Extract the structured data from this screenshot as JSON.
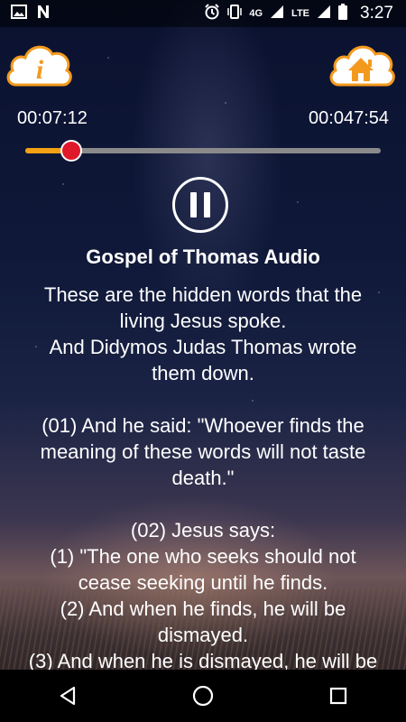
{
  "status_bar": {
    "left_icons": [
      "image-icon",
      "notification-n-icon"
    ],
    "network": "4G",
    "network_type": "LTE",
    "time": "3:27"
  },
  "player": {
    "elapsed": "00:07:12",
    "total": "00:047:54",
    "progress_fraction": 0.13,
    "state": "playing"
  },
  "title": "Gospel of Thomas Audio",
  "text": "These are the hidden words that the\nliving Jesus spoke.\nAnd Didymos Judas Thomas wrote\nthem down.\n\n(01) And he said: \"Whoever finds the\nmeaning of these words will not taste\ndeath.\"\n\n(02) Jesus says:\n(1) \"The one who seeks should not\ncease seeking until he finds.\n(2) And when he finds, he will be\ndismayed.\n(3) And when he is dismayed, he will be",
  "colors": {
    "accent_orange": "#f2a213",
    "thumb_red": "#e0182b",
    "cloud_fill": "#ffffff",
    "cloud_stroke": "#f39a1e"
  },
  "buttons": {
    "info_icon": "info-icon",
    "home_icon": "home-icon"
  },
  "nav": [
    "back-icon",
    "home-circle-icon",
    "recents-square-icon"
  ]
}
